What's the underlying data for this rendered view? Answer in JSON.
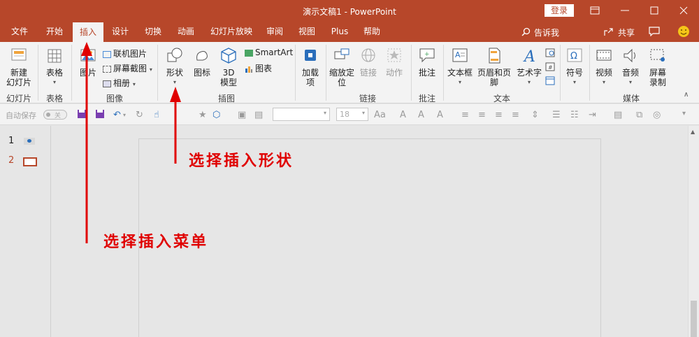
{
  "window": {
    "title": "演示文稿1  -  PowerPoint",
    "login_label": "登录"
  },
  "tabs": [
    {
      "label": "文件"
    },
    {
      "label": "开始"
    },
    {
      "label": "插入",
      "active": true
    },
    {
      "label": "设计"
    },
    {
      "label": "切换"
    },
    {
      "label": "动画"
    },
    {
      "label": "幻灯片放映"
    },
    {
      "label": "审阅"
    },
    {
      "label": "视图"
    },
    {
      "label": "Plus"
    },
    {
      "label": "帮助"
    }
  ],
  "tell_me": "告诉我",
  "share": "共享",
  "ribbon": {
    "new_slide": "新建\n幻灯片",
    "table": "表格",
    "picture": "图片",
    "online_picture": "联机图片",
    "screenshot": "屏幕截图",
    "album": "相册",
    "shapes": "形状",
    "icons": "图标",
    "model3d": "3D\n模型",
    "smartart": "SmartArt",
    "chart": "图表",
    "addins": "加载\n项",
    "zoom": "缩放定\n位",
    "link": "链接",
    "action": "动作",
    "comment": "批注",
    "textbox": "文本框",
    "header_footer": "页眉和页脚",
    "wordart": "艺术字",
    "symbol": "符号",
    "video": "视频",
    "audio": "音频",
    "screen_record": "屏幕\n录制",
    "groups": {
      "slides": "幻灯片",
      "tables": "表格",
      "images": "图像",
      "illustrations": "插图",
      "links": "链接",
      "comments": "批注",
      "text": "文本",
      "media": "媒体"
    }
  },
  "qat": {
    "autosave": "自动保存",
    "autosave_state": "关",
    "font_size": "18"
  },
  "slides": [
    {
      "num": "1"
    },
    {
      "num": "2"
    }
  ],
  "annotations": {
    "shape_hint": "选择插入形状",
    "menu_hint": "选择插入菜单"
  },
  "colors": {
    "accent": "#b7472a",
    "annotation": "#e00000"
  }
}
